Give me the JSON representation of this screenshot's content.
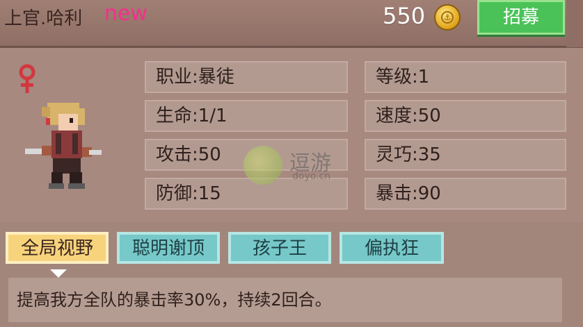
{
  "header": {
    "name": "上官.哈利",
    "badge": "new",
    "gold": "550",
    "recruit_label": "招募"
  },
  "character": {
    "gender_icon": "female-symbol",
    "sprite_icon": "warrior-sprite"
  },
  "stats": {
    "job": "职业:暴徒",
    "level": "等级:1",
    "hp": "生命:1/1",
    "speed": "速度:50",
    "attack": "攻击:50",
    "agility": "灵巧:35",
    "defense": "防御:15",
    "crit": "暴击:90"
  },
  "watermark": {
    "name": "逗游",
    "domain": "doyo.cn"
  },
  "skills": [
    {
      "label": "全局视野",
      "active": true
    },
    {
      "label": "聪明谢顶",
      "active": false
    },
    {
      "label": "孩子王",
      "active": false
    },
    {
      "label": "偏执狂",
      "active": false
    }
  ],
  "description": "提高我方全队的暴击率30%，持续2回合。",
  "colors": {
    "recruit_green": "#4ac258",
    "active_skill": "#f7d37c",
    "skill_teal": "#76c8c9",
    "new_badge": "#f3308a"
  }
}
